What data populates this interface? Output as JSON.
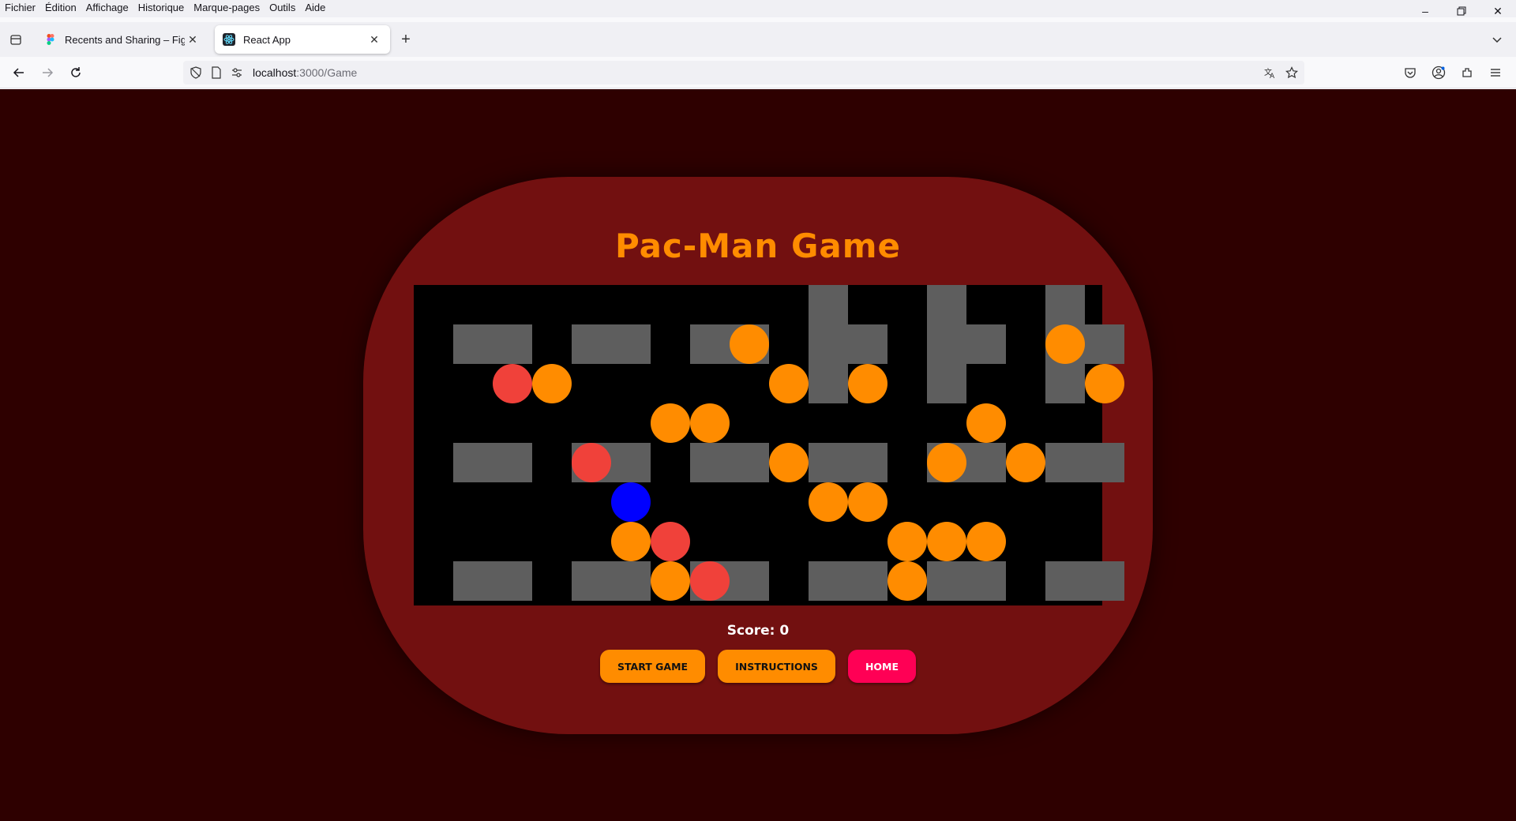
{
  "browser": {
    "menu": [
      "Fichier",
      "Édition",
      "Affichage",
      "Historique",
      "Marque-pages",
      "Outils",
      "Aide"
    ],
    "tabs": [
      {
        "title": "Recents and Sharing – Figma",
        "icon": "figma-icon",
        "active": false
      },
      {
        "title": "React App",
        "icon": "react-icon",
        "active": true
      }
    ],
    "url_host": "localhost",
    "url_path": ":3000/Game"
  },
  "game": {
    "title": "Pac-Man Game",
    "score_label": "Score: 0",
    "score": 0,
    "buttons": {
      "start": "START GAME",
      "instructions": "INSTRUCTIONS",
      "home": "HOME"
    },
    "colors": {
      "background": "#2e0000",
      "console": "#721010",
      "board": "#000000",
      "wall": "#5e5e5e",
      "dot": "#ff8c00",
      "ghost": "#f0413a",
      "pacman": "#0000ff",
      "title": "#ff8c00",
      "button_primary": "#ff8c00",
      "button_home": "#ff0055"
    },
    "walls": [
      [
        1,
        1
      ],
      [
        2,
        1
      ],
      [
        4,
        1
      ],
      [
        5,
        1
      ],
      [
        7,
        1
      ],
      [
        8,
        1
      ],
      [
        10,
        0
      ],
      [
        10,
        1
      ],
      [
        10,
        2
      ],
      [
        11,
        1
      ],
      [
        13,
        0
      ],
      [
        13,
        1
      ],
      [
        13,
        2
      ],
      [
        14,
        1
      ],
      [
        16,
        0
      ],
      [
        16,
        1
      ],
      [
        16,
        2
      ],
      [
        17,
        1
      ],
      [
        1,
        4
      ],
      [
        2,
        4
      ],
      [
        4,
        4
      ],
      [
        5,
        4
      ],
      [
        7,
        4
      ],
      [
        8,
        4
      ],
      [
        10,
        4
      ],
      [
        11,
        4
      ],
      [
        13,
        4
      ],
      [
        14,
        4
      ],
      [
        16,
        4
      ],
      [
        17,
        4
      ],
      [
        1,
        7
      ],
      [
        2,
        7
      ],
      [
        4,
        7
      ],
      [
        5,
        7
      ],
      [
        7,
        7
      ],
      [
        8,
        7
      ],
      [
        10,
        7
      ],
      [
        11,
        7
      ],
      [
        13,
        7
      ],
      [
        14,
        7
      ],
      [
        16,
        7
      ],
      [
        17,
        7
      ]
    ],
    "dots": [
      [
        8,
        1
      ],
      [
        16,
        1
      ],
      [
        3,
        2
      ],
      [
        9,
        2
      ],
      [
        11,
        2
      ],
      [
        17,
        2
      ],
      [
        6,
        3
      ],
      [
        7,
        3
      ],
      [
        14,
        3
      ],
      [
        9,
        4
      ],
      [
        13,
        4
      ],
      [
        15,
        4
      ],
      [
        10,
        5
      ],
      [
        11,
        5
      ],
      [
        5,
        6
      ],
      [
        12,
        6
      ],
      [
        13,
        6
      ],
      [
        14,
        6
      ],
      [
        6,
        7
      ],
      [
        12,
        7
      ]
    ],
    "ghosts": [
      [
        2,
        2
      ],
      [
        4,
        4
      ],
      [
        6,
        6
      ],
      [
        7,
        7
      ]
    ],
    "pacman": [
      5,
      5
    ]
  }
}
